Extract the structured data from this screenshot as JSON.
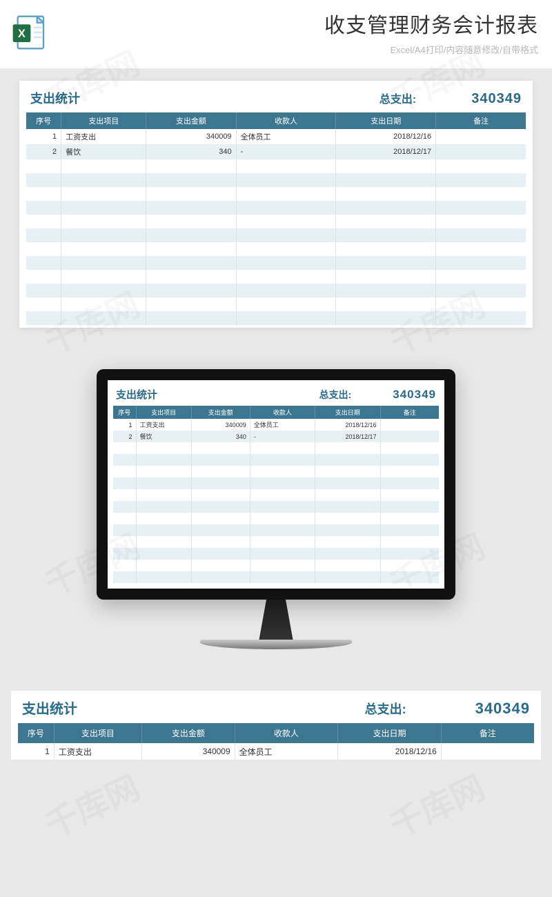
{
  "header": {
    "title": "收支管理财务会计报表",
    "subtitle": "Excel/A4打印/内容随意修改/自带格式"
  },
  "sheet": {
    "title": "支出统计",
    "total_label": "总支出:",
    "total_value": "340349",
    "columns": {
      "seq": "序号",
      "item": "支出项目",
      "amount": "支出金额",
      "payee": "收款人",
      "date": "支出日期",
      "note": "备注"
    },
    "rows": [
      {
        "seq": "1",
        "item": "工资支出",
        "amount": "340009",
        "payee": "全体员工",
        "date": "2018/12/16",
        "note": ""
      },
      {
        "seq": "2",
        "item": "餐饮",
        "amount": "340",
        "payee": "-",
        "date": "2018/12/17",
        "note": ""
      }
    ],
    "empty_row_count": 12
  },
  "watermark_text": "千库网"
}
